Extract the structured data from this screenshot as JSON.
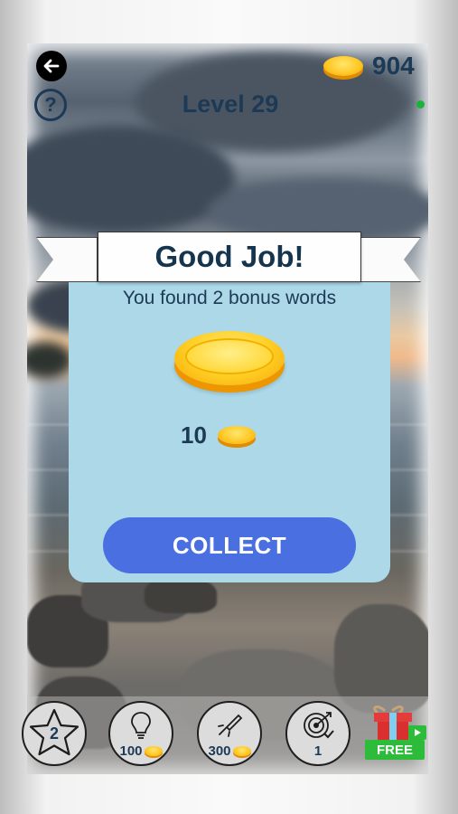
{
  "header": {
    "level_title": "Level 29",
    "coin_balance": "904",
    "back_icon": "arrow-left-icon",
    "help_icon": "question-mark-icon"
  },
  "dialog": {
    "title": "Good Job!",
    "message": "You found 2 bonus words",
    "reward_amount": "10",
    "collect_label": "COLLECT"
  },
  "toolbar": {
    "items": [
      {
        "icon": "star-icon",
        "label": "2"
      },
      {
        "icon": "lightbulb-icon",
        "label": "100"
      },
      {
        "icon": "rocket-icon",
        "label": "300"
      },
      {
        "icon": "target-icon",
        "label": "1"
      },
      {
        "icon": "gift-icon",
        "label": "FREE"
      }
    ]
  },
  "colors": {
    "accent_blue": "#4a6fe0",
    "dialog_bg": "#acd8e8",
    "text_navy": "#1c3a55",
    "coin_gold": "#ffc928",
    "free_green": "#2dbb3a"
  }
}
